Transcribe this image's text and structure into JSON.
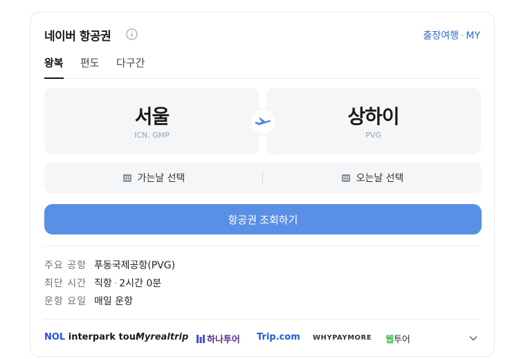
{
  "header": {
    "title": "네이버 항공권",
    "link_business": "출장여행",
    "link_separator": "·",
    "link_my": "MY"
  },
  "tabs": [
    {
      "label": "왕복",
      "active": true
    },
    {
      "label": "편도",
      "active": false
    },
    {
      "label": "다구간",
      "active": false
    }
  ],
  "route": {
    "from": {
      "city": "서울",
      "code": "ICN, GMP"
    },
    "to": {
      "city": "상하이",
      "code": "PVG"
    }
  },
  "dates": {
    "depart_label": "가는날 선택",
    "return_label": "오는날 선택"
  },
  "search": {
    "label": "항공권 조회하기"
  },
  "info": {
    "airport_label": "주요 공항",
    "airport_value": "푸동국제공항(PVG)",
    "shortest_label": "최단 시간",
    "shortest_type": "직항",
    "shortest_sep": "·",
    "shortest_time": "2시간 0분",
    "days_label": "운항 요일",
    "days_value": "매일 운항"
  },
  "partners": {
    "nol_prefix": "NOL",
    "nol_rest": " interpark tour",
    "myrealtrip": "Myrealtrip",
    "hana": "하나투어",
    "trip": "Trip.com",
    "whypaymore": "WHYPAYMORE",
    "web_prefix": "웹",
    "web_suffix": "투어"
  },
  "colors": {
    "accent": "#5a8fe6",
    "link": "#2a6bd8",
    "plane": "#4a86e8"
  }
}
